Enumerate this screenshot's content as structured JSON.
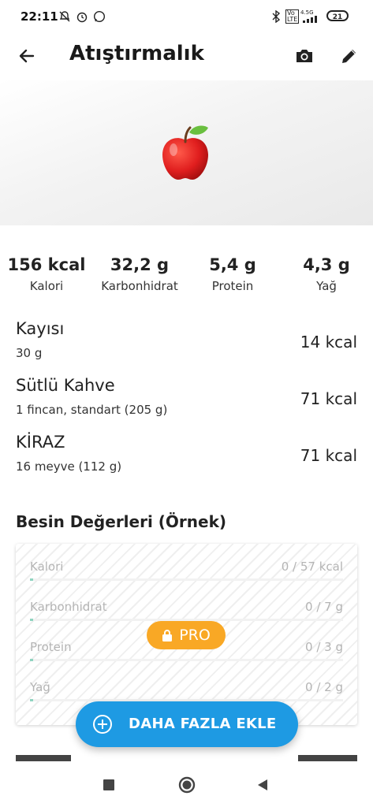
{
  "status_bar": {
    "time": "22:11",
    "battery": "21",
    "network": "4.5G"
  },
  "app_bar": {
    "title": "Atıştırmalık",
    "back_icon": "arrow-back-icon",
    "camera_icon": "camera-icon",
    "edit_icon": "pencil-icon"
  },
  "hero": {
    "image": "red-apple-icon"
  },
  "summary": [
    {
      "value": "156 kcal",
      "label": "Kalori"
    },
    {
      "value": "32,2 g",
      "label": "Karbonhidrat"
    },
    {
      "value": "5,4 g",
      "label": "Protein"
    },
    {
      "value": "4,3 g",
      "label": "Yağ"
    }
  ],
  "foods": [
    {
      "name": "Kayısı",
      "portion": "30 g",
      "kcal": "14 kcal"
    },
    {
      "name": "Sütlü Kahve",
      "portion": "1 fincan, standart (205 g)",
      "kcal": "71 kcal"
    },
    {
      "name": "KİRAZ",
      "portion": "16 meyve (112 g)",
      "kcal": "71 kcal"
    }
  ],
  "nutrients": {
    "title": "Besin Değerleri (Örnek)",
    "rows": [
      {
        "label": "Kalori",
        "value": "0 / 57 kcal",
        "progress": 0
      },
      {
        "label": "Karbonhidrat",
        "value": "0 / 7 g",
        "progress": 0
      },
      {
        "label": "Protein",
        "value": "0 / 3 g",
        "progress": 0
      },
      {
        "label": "Yağ",
        "value": "0 / 2 g",
        "progress": 0
      }
    ],
    "pro_badge": "PRO",
    "lock_icon": "lock-icon"
  },
  "fab": {
    "label": "DAHA FAZLA EKLE",
    "icon": "add-circle-icon"
  },
  "colors": {
    "accent": "#1e9ae3",
    "pro": "#f9a825",
    "progress": "#8fd4c0"
  },
  "nav_bar": {
    "recent_icon": "square-icon",
    "home_icon": "circle-icon",
    "back_icon": "triangle-back-icon"
  }
}
